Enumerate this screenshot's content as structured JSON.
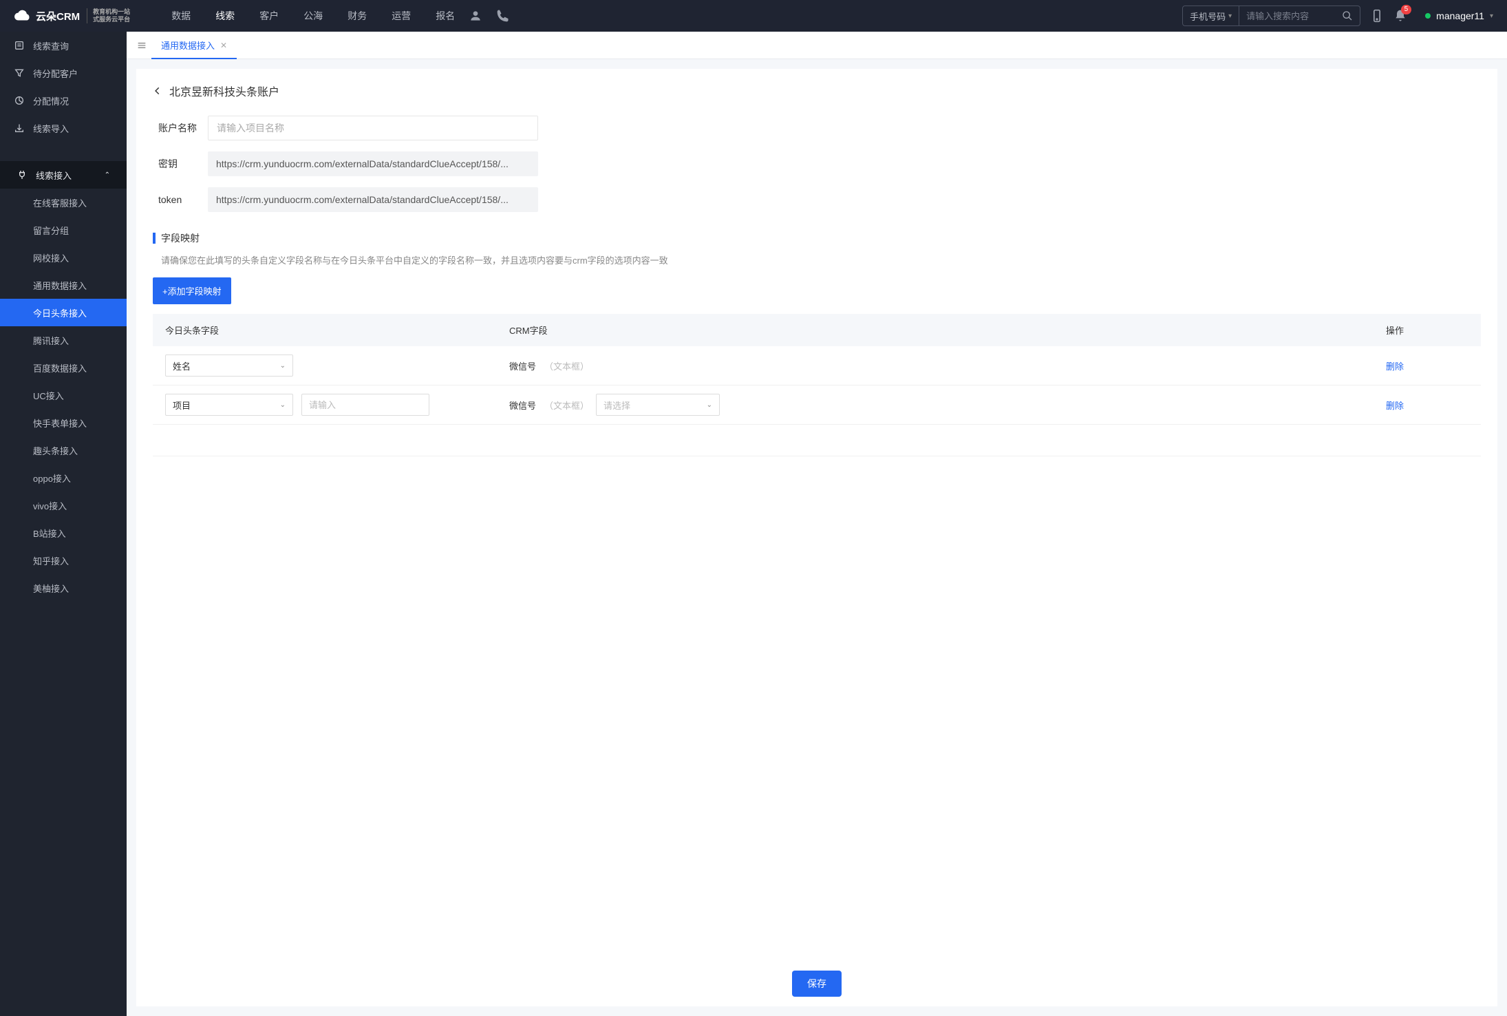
{
  "header": {
    "logo_main": "云朵CRM",
    "logo_sub1": "教育机构一站",
    "logo_sub2": "式服务云平台",
    "nav": [
      "数据",
      "线索",
      "客户",
      "公海",
      "财务",
      "运营",
      "报名"
    ],
    "nav_active_index": 1,
    "search_select": "手机号码",
    "search_placeholder": "请输入搜索内容",
    "notif_count": "5",
    "username": "manager11"
  },
  "sidebar": {
    "items": [
      {
        "label": "线索查询",
        "icon": "list-icon"
      },
      {
        "label": "待分配客户",
        "icon": "filter-icon"
      },
      {
        "label": "分配情况",
        "icon": "chart-icon"
      },
      {
        "label": "线索导入",
        "icon": "import-icon"
      }
    ],
    "section_label": "线索接入",
    "subs": [
      {
        "label": "在线客服接入"
      },
      {
        "label": "留言分组"
      },
      {
        "label": "网校接入"
      },
      {
        "label": "通用数据接入"
      },
      {
        "label": "今日头条接入",
        "active": true
      },
      {
        "label": "腾讯接入"
      },
      {
        "label": "百度数据接入"
      },
      {
        "label": "UC接入"
      },
      {
        "label": "快手表单接入"
      },
      {
        "label": "趣头条接入"
      },
      {
        "label": "oppo接入"
      },
      {
        "label": "vivo接入"
      },
      {
        "label": "B站接入"
      },
      {
        "label": "知乎接入"
      },
      {
        "label": "美柚接入"
      }
    ]
  },
  "tabs": {
    "items": [
      {
        "label": "通用数据接入",
        "active": true
      }
    ]
  },
  "page": {
    "title": "北京昱新科技头条账户",
    "form": {
      "account_label": "账户名称",
      "account_placeholder": "请输入项目名称",
      "account_value": "",
      "key_label": "密钥",
      "key_value": "https://crm.yunduocrm.com/externalData/standardClueAccept/158/...",
      "token_label": "token",
      "token_value": "https://crm.yunduocrm.com/externalData/standardClueAccept/158/..."
    },
    "mapping": {
      "title": "字段映射",
      "desc": "请确保您在此填写的头条自定义字段名称与在今日头条平台中自定义的字段名称一致，并且选项内容要与crm字段的选项内容一致",
      "add_btn": "+添加字段映射",
      "columns": {
        "c1": "今日头条字段",
        "c2": "CRM字段",
        "c3": "操作"
      },
      "rows": [
        {
          "field_select": "姓名",
          "crm_field": "微信号",
          "crm_sub": "（文本框）",
          "action": "删除"
        },
        {
          "field_select": "项目",
          "extra_input_placeholder": "请输入",
          "crm_field": "微信号",
          "crm_sub": "（文本框）",
          "crm_select_placeholder": "请选择",
          "action": "删除"
        }
      ]
    },
    "save_btn": "保存"
  }
}
